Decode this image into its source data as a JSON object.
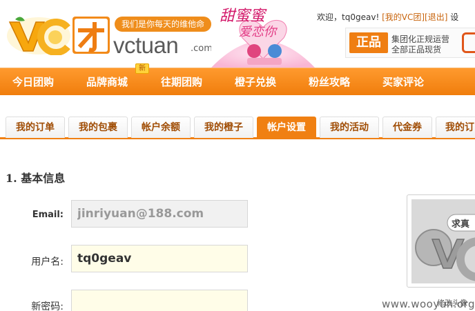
{
  "header": {
    "slogan": "我们是你每天的维他命",
    "brand_word": "vctuan",
    "brand_domain": ".com",
    "banner_text": "甜蜜蜜 爱恋你",
    "user": {
      "welcome": "欢迎，",
      "username": "tq0geav",
      "exclaim": "!",
      "my_vc_link": "[我的VC团]",
      "logout_link": "[退出]",
      "extra": "设"
    },
    "promo": {
      "badge": "正品",
      "line1": "集团化正规运营",
      "line2": "全部正品现货"
    }
  },
  "main_nav": {
    "items": [
      "今日团购",
      "品牌商城",
      "往期团购",
      "橙子兑换",
      "粉丝攻略",
      "买家评论"
    ],
    "new_badge": "新"
  },
  "sub_tabs": {
    "items": [
      "我的订单",
      "我的包裹",
      "帐户余额",
      "我的橙子",
      "帐户设置",
      "我的活动",
      "代金券",
      "我的订"
    ],
    "active_index": 4
  },
  "section": {
    "title": "1. 基本信息"
  },
  "form": {
    "email_label": "Email:",
    "email_value": "jinriyuan@188.com",
    "username_label": "用户名:",
    "username_value": "tq0geav",
    "password_label": "新密码:",
    "password_value": ""
  },
  "avatar": {
    "image_text": "求真",
    "caption": "修改头像"
  },
  "watermark": "www.wooyun.org",
  "colors": {
    "brand_orange": "#f08012",
    "link_brown": "#c8640c",
    "tab_text": "#a04d05"
  }
}
